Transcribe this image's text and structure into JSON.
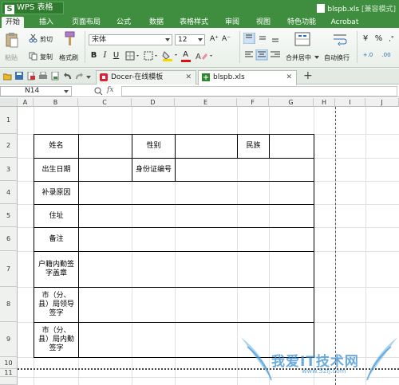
{
  "titlebar": {
    "app_name": "WPS 表格",
    "file_name": "blspb.xls",
    "compat_mode": "[兼容模式]"
  },
  "menu": {
    "tabs": [
      "开始",
      "插入",
      "页面布局",
      "公式",
      "数据",
      "表格样式",
      "审阅",
      "视图",
      "特色功能",
      "Acrobat"
    ],
    "active_tab": "开始"
  },
  "ribbon": {
    "paste_label": "粘贴",
    "cut_label": "剪切",
    "copy_label": "复制",
    "format_painter_label": "格式刷",
    "font_name": "宋体",
    "font_size": "12",
    "merge_center_label": "合并居中",
    "wrap_text_label": "自动换行",
    "number_format_symbol": "¥",
    "percent_symbol": "%",
    "increase_decimal": "+.0",
    "decrease_decimal": ".00"
  },
  "doc_tabs": [
    {
      "label": "Docer-在线模板",
      "active": false
    },
    {
      "label": "blspb.xls",
      "active": true
    }
  ],
  "formula_bar": {
    "cell_ref": "N14",
    "fx_label": "fx",
    "content": ""
  },
  "columns": [
    "A",
    "B",
    "C",
    "D",
    "E",
    "F",
    "G",
    "H",
    "I",
    "J"
  ],
  "rows": [
    "1",
    "2",
    "3",
    "4",
    "5",
    "6",
    "7",
    "8",
    "9",
    "10",
    "11"
  ],
  "form": {
    "name_label": "姓名",
    "gender_label": "性别",
    "ethnicity_label": "民族",
    "birth_date_label": "出生日期",
    "id_number_label": "身份证编号",
    "reason_label": "补录原因",
    "address_label": "住址",
    "remarks_label": "备注",
    "household_seal_label_1": "户籍内勤签",
    "household_seal_label_2": "字盖章",
    "bureau_leader_label_1": "市（分、",
    "bureau_leader_label_2": "县）局领导",
    "bureau_leader_label_3": "签字",
    "bureau_clerk_label_1": "市（分、",
    "bureau_clerk_label_2": "县）局内勤",
    "bureau_clerk_label_3": "签字"
  },
  "watermark": {
    "site_text": "我爱IT技术网",
    "url_text": "www.52ij.com"
  },
  "colors": {
    "title_green": "#3f8e3f",
    "ribbon_bg": "#eef3ee",
    "grid_line": "#e1e1e1",
    "watermark_blue": "#3a8fd0"
  }
}
